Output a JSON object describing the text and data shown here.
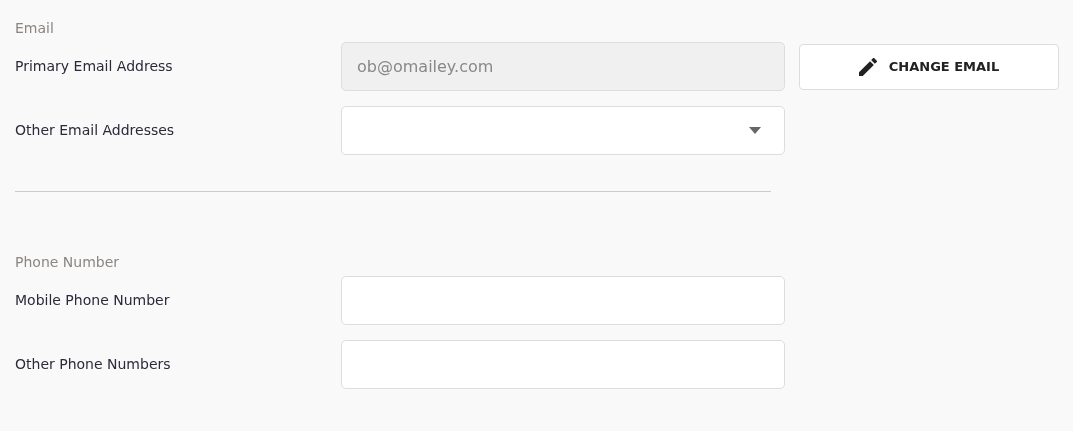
{
  "sections": [
    {
      "title": "Email",
      "fields": [
        {
          "kind": "input",
          "label": "Primary Email Address",
          "value": "ob@omailey.com",
          "disabled": true,
          "button": {
            "label": "CHANGE EMAIL"
          }
        },
        {
          "kind": "select",
          "label": "Other Email Addresses",
          "disabled": false
        }
      ]
    },
    {
      "title": "Phone Number",
      "fields": [
        {
          "kind": "input",
          "label": "Mobile Phone Number",
          "disabled": false
        },
        {
          "kind": "input",
          "label": "Other Phone Numbers",
          "disabled": false
        }
      ]
    }
  ]
}
